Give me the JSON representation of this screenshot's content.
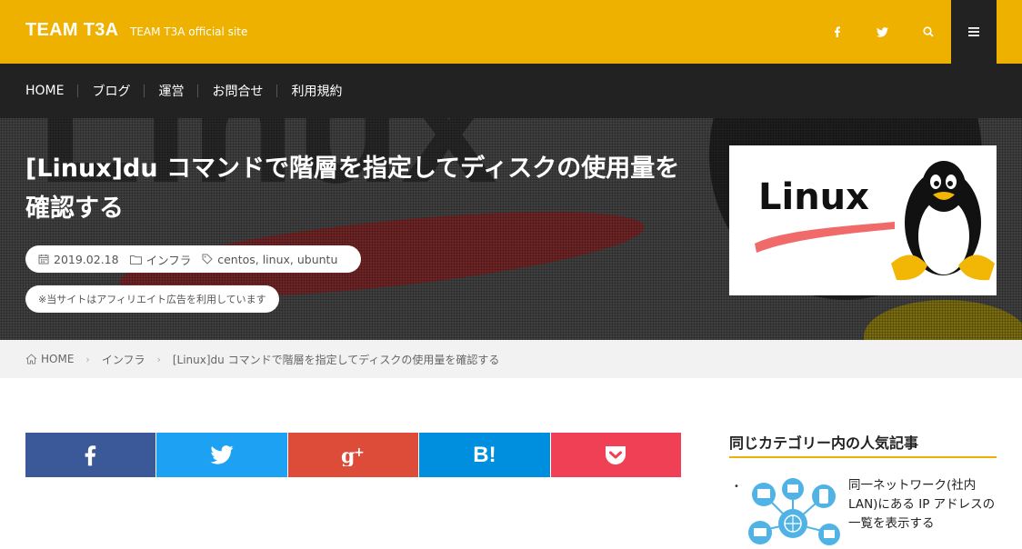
{
  "header": {
    "logo": "TEAM T3A",
    "tagline": "TEAM T3A official site",
    "icons": [
      "facebook-icon",
      "twitter-icon",
      "search-icon",
      "hamburger-menu-icon"
    ],
    "accent_color": "#eeb100"
  },
  "nav": {
    "items": [
      {
        "label": "HOME"
      },
      {
        "label": "ブログ"
      },
      {
        "label": "運営"
      },
      {
        "label": "お問合せ"
      },
      {
        "label": "利用規約"
      }
    ]
  },
  "hero": {
    "title": "[Linux]du コマンドで階層を指定してディスクの使用量を確認する",
    "date": "2019.02.18",
    "category": "インフラ",
    "tags": "centos, linux, ubuntu",
    "notice": "※当サイトはアフィリエイト広告を利用しています",
    "thumbnail_text": "Linux"
  },
  "breadcrumb": {
    "home": "HOME",
    "category": "インフラ",
    "current": "[Linux]du コマンドで階層を指定してディスクの使用量を確認する"
  },
  "share": {
    "buttons": [
      {
        "name": "facebook",
        "color": "#3b5998"
      },
      {
        "name": "twitter",
        "color": "#1da1f2"
      },
      {
        "name": "google-plus",
        "color": "#dd4b39"
      },
      {
        "name": "hatena-bookmark",
        "label": "B!",
        "color": "#008fde"
      },
      {
        "name": "pocket",
        "color": "#ef4056"
      }
    ]
  },
  "sidebar": {
    "heading": "同じカテゴリー内の人気記事",
    "items": [
      {
        "bullet": "•",
        "title": "同一ネットワーク(社内LAN)にある IP アドレスの一覧を表示する"
      }
    ]
  }
}
